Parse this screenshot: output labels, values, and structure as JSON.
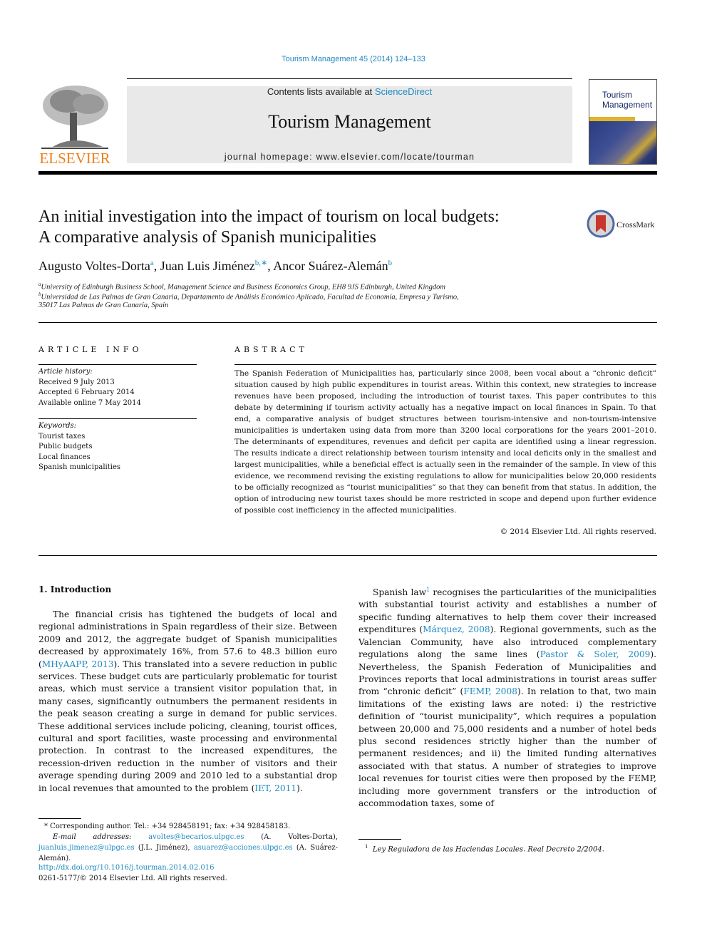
{
  "header": {
    "journal_ref": "Tourism Management 45 (2014) 124–133",
    "contents_prefix": "Contents lists available at ",
    "contents_link": "ScienceDirect",
    "journal_title": "Tourism Management",
    "homepage": "journal homepage: www.elsevier.com/locate/tourman",
    "publisher_logo_text": "ELSEVIER",
    "cover_title_line1": "Tourism",
    "cover_title_line2": "Management",
    "crossmark_label": "CrossMark"
  },
  "colors": {
    "link": "#1f8ac0",
    "elsevier_orange": "#f07f1a",
    "header_box_bg": "#e9e9e9"
  },
  "article": {
    "title_line1": "An initial investigation into the impact of tourism on local budgets:",
    "title_line2": "A comparative analysis of Spanish municipalities",
    "authors": [
      {
        "name": "Augusto Voltes-Dorta",
        "sup": "a"
      },
      {
        "name": "Juan Luis Jiménez",
        "sup": "b,∗"
      },
      {
        "name": "Ancor Suárez-Alemán",
        "sup": "b"
      }
    ],
    "affiliations": [
      {
        "sup": "a",
        "text": "University of Edinburgh Business School, Management Science and Business Economics Group, EH8 9JS Edinburgh, United Kingdom"
      },
      {
        "sup": "b",
        "text": "Universidad de Las Palmas de Gran Canaria, Departamento de Análisis Económico Aplicado, Facultad de Economía, Empresa y Turismo,"
      },
      {
        "sup": "",
        "text": "35017 Las Palmas de Gran Canaria, Spain"
      }
    ]
  },
  "article_info": {
    "heading": "ARTICLE INFO",
    "history_label": "Article history:",
    "history": [
      "Received 9 July 2013",
      "Accepted 6 February 2014",
      "Available online 7 May 2014"
    ],
    "keywords_label": "Keywords:",
    "keywords": [
      "Tourist taxes",
      "Public budgets",
      "Local finances",
      "Spanish municipalities"
    ]
  },
  "abstract": {
    "heading": "ABSTRACT",
    "text": "The Spanish Federation of Municipalities has, particularly since 2008, been vocal about a “chronic deficit” situation caused by high public expenditures in tourist areas. Within this context, new strategies to increase revenues have been proposed, including the introduction of tourist taxes. This paper contributes to this debate by determining if tourism activity actually has a negative impact on local finances in Spain. To that end, a comparative analysis of budget structures between tourism-intensive and non-tourism-intensive municipalities is undertaken using data from more than 3200 local corporations for the years 2001–2010. The determinants of expenditures, revenues and deficit per capita are identified using a linear regression. The results indicate a direct relationship between tourism intensity and local deficits only in the smallest and largest municipalities, while a beneficial effect is actually seen in the remainder of the sample. In view of this evidence, we recommend revising the existing regulations to allow for municipalities below 20,000 residents to be officially recognized as “tourist municipalities” so that they can benefit from that status. In addition, the option of introducing new tourist taxes should be more restricted in scope and depend upon further evidence of possible cost inefficiency in the affected municipalities.",
    "copyright": "© 2014 Elsevier Ltd. All rights reserved."
  },
  "introduction": {
    "heading": "1.  Introduction",
    "left": {
      "p1_a": "The financial crisis has tightened the budgets of local and regional administrations in Spain regardless of their size. Between 2009 and 2012, the aggregate budget of Spanish municipalities decreased by approximately 16%, from 57.6 to 48.3 billion euro (",
      "cite1": "MHyAAPP, 2013",
      "p1_b": "). This translated into a severe reduction in public services. These budget cuts are particularly problematic for tourist areas, which must service a transient visitor population that, in many cases, significantly outnumbers the permanent residents in the peak season creating a surge in demand for public services. These additional services include policing, cleaning, tourist offices, cultural and sport facilities, waste processing and environmental protection. In contrast to the increased expenditures, the recession-driven reduction in the number of visitors and their average spending during 2009 and 2010 led to a substantial drop in local revenues that amounted to the problem (",
      "cite2": "IET, 2011",
      "p1_c": ")."
    },
    "right": {
      "a": "Spanish law",
      "fn_mark": "1",
      "b": " recognises the particularities of the municipalities with substantial tourist activity and establishes a number of specific funding alternatives to help them cover their increased expenditures (",
      "cite1": "Márquez, 2008",
      "c": "). Regional governments, such as the Valencian Community, have also introduced complementary regulations along the same lines (",
      "cite2": "Pastor & Soler, 2009",
      "d": "). Nevertheless, the Spanish Federation of Municipalities and Provinces reports that local administrations in tourist areas suffer from “chronic deficit” (",
      "cite3": "FEMP, 2008",
      "e": "). In relation to that, two main limitations of the existing laws are noted: i) the restrictive definition of “tourist municipality”, which requires a population between 20,000 and 75,000 residents and a number of hotel beds plus second residences strictly higher than the number of permanent residences; and ii) the limited funding alternatives associated with that status. A number of strategies to improve local revenues for tourist cities were then proposed by the FEMP, including more government transfers or the introduction of accommodation taxes, some of"
    }
  },
  "footnotes": {
    "corresponding": "* Corresponding author. Tel.: +34 928458191; fax: +34 928458183.",
    "email_label": "E-mail addresses:",
    "email1": "avoltes@becarios.ulpgc.es",
    "email1_name": " (A. Voltes-Dorta), ",
    "email2": "juanluis.jimenez@ulpgc.es",
    "email2_name": " (J.L. Jiménez), ",
    "email3": "asuarez@acciones.ulpgc.es",
    "email3_name": " (A. Suárez-Alemán).",
    "doi": "http://dx.doi.org/10.1016/j.tourman.2014.02.016",
    "issn_copyright": "0261-5177/© 2014 Elsevier Ltd. All rights reserved.",
    "fn1_mark": "1",
    "fn1_text": "Ley Reguladora de las Haciendas Locales. Real Decreto 2/2004."
  }
}
